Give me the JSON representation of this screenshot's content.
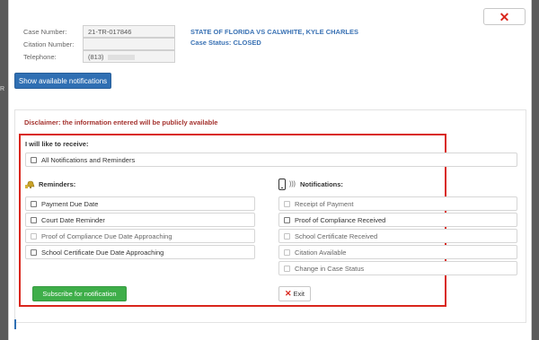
{
  "page_edge": "R",
  "case_info": {
    "case_number_label": "Case Number:",
    "case_number_value": "21-TR-017846",
    "citation_number_label": "Citation Number:",
    "citation_number_value": "",
    "telephone_label": "Telephone:",
    "telephone_value": "(813)",
    "case_title": "STATE OF FLORIDA VS CALWHITE, KYLE CHARLES",
    "case_status": "Case Status: CLOSED"
  },
  "close_label": "✕",
  "show_notifications_label": "Show available notifications",
  "disclaimer": "Disclaimer: the information entered will be publicly available",
  "receive_label": "I will like to receive:",
  "all_notifications_label": "All Notifications and Reminders",
  "reminders": {
    "heading": "Reminders:",
    "items": [
      {
        "label": "Payment Due Date",
        "enabled": true
      },
      {
        "label": "Court Date Reminder",
        "enabled": true
      },
      {
        "label": "Proof of Compliance Due Date Approaching",
        "enabled": false
      },
      {
        "label": "School Certificate Due Date Approaching",
        "enabled": true
      }
    ]
  },
  "notifications": {
    "heading": "Notifications:",
    "items": [
      {
        "label": "Receipt of Payment",
        "enabled": false
      },
      {
        "label": "Proof of Compliance Received",
        "enabled": true
      },
      {
        "label": "School Certificate Received",
        "enabled": false
      },
      {
        "label": "Citation Available",
        "enabled": false
      },
      {
        "label": "Change in Case Status",
        "enabled": false
      }
    ]
  },
  "subscribe_label": "Subscribe for notification",
  "exit_label": "Exit",
  "colors": {
    "accent_blue": "#2f6fb3",
    "title_blue": "#3a72b4",
    "disclaimer_red": "#a4322e",
    "highlight_red": "#d9261c",
    "subscribe_green": "#3eae49"
  },
  "icons": {
    "close": "close-icon",
    "reminders": "bell-icon",
    "notifications": "phone-icon",
    "exit": "x-icon"
  }
}
